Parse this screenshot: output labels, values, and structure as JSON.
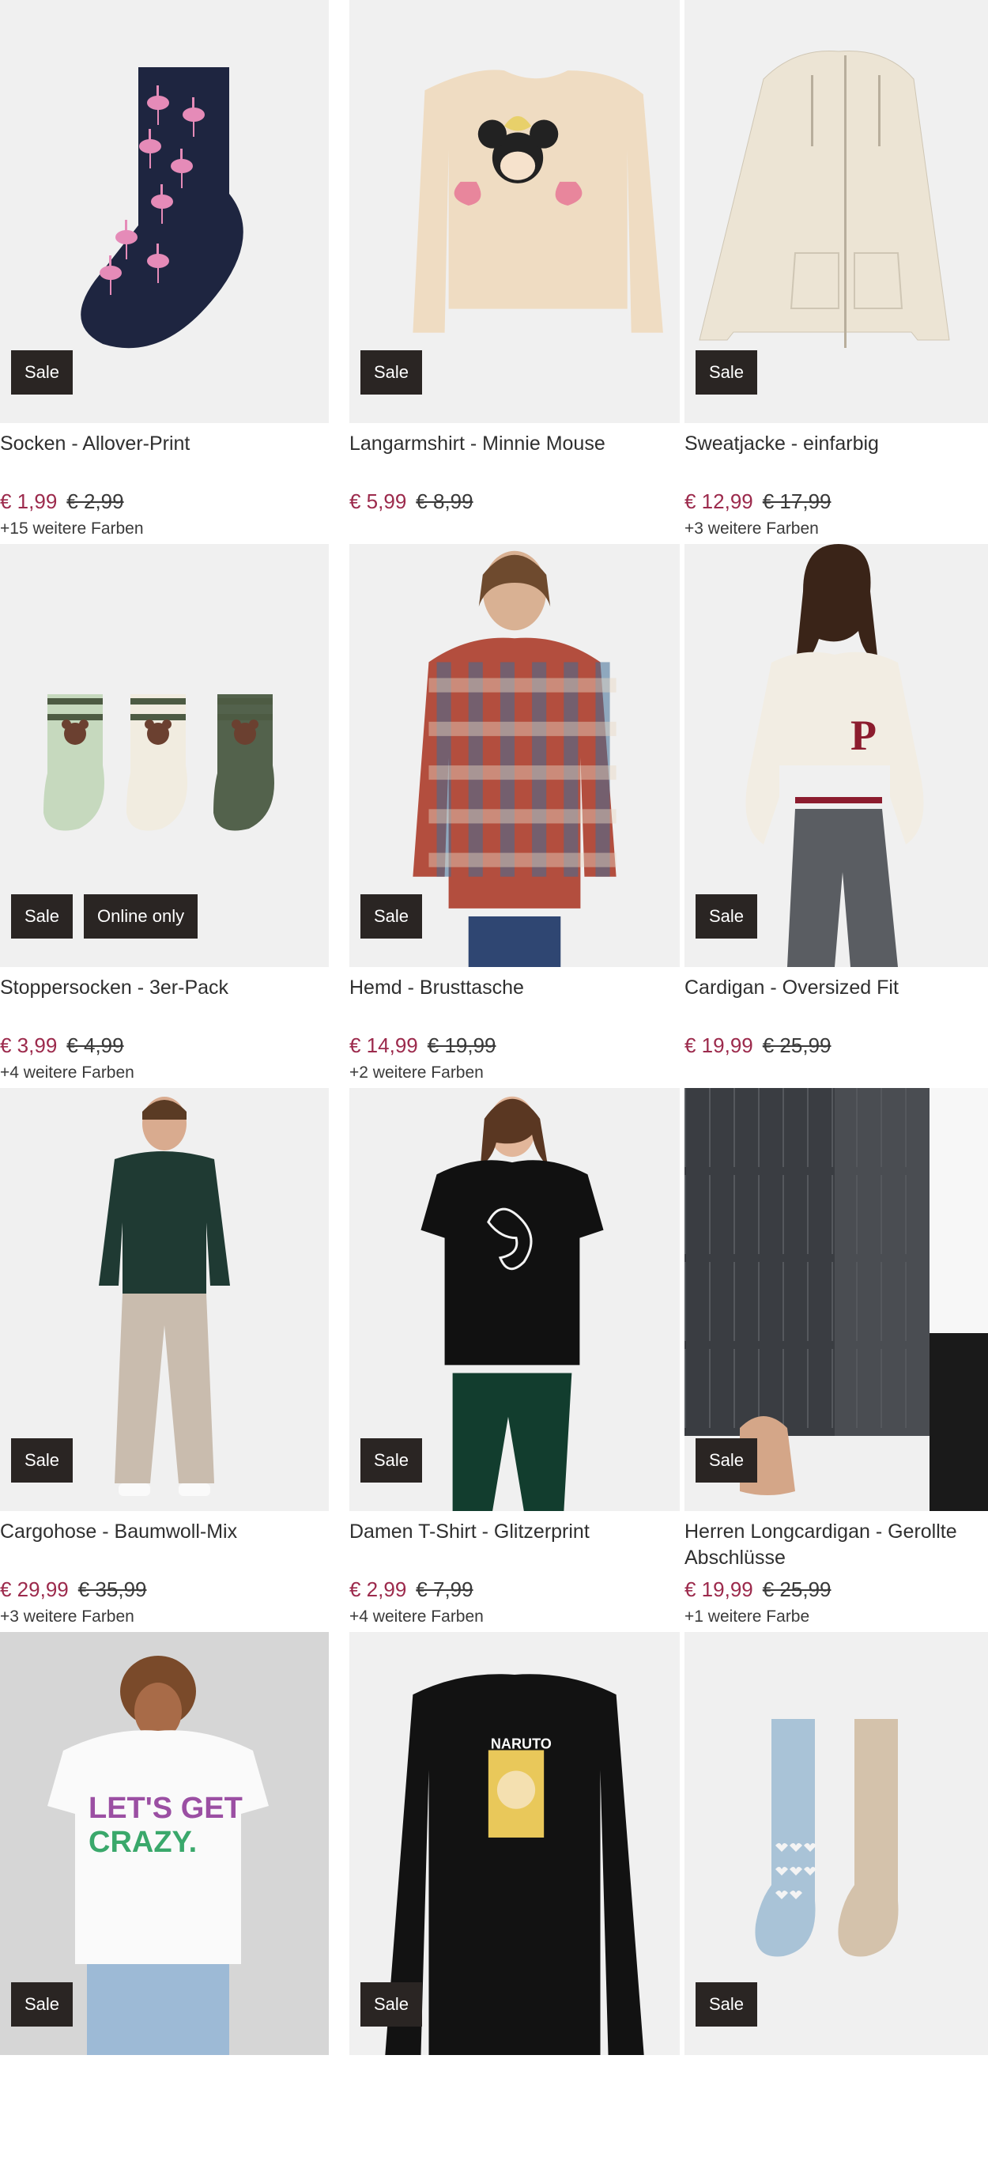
{
  "products": [
    {
      "name": "Socken - Allover-Print",
      "price": "€ 1,99",
      "old_price": "€ 2,99",
      "colors": "+15 weitere Farben",
      "badges": [
        "Sale"
      ],
      "image": "sock-flamingo"
    },
    {
      "name": "Langarmshirt - Minnie Mouse",
      "price": "€ 5,99",
      "old_price": "€ 8,99",
      "colors": "",
      "badges": [
        "Sale"
      ],
      "image": "longsleeve-minnie"
    },
    {
      "name": "Sweatjacke - einfarbig",
      "price": "€ 12,99",
      "old_price": "€ 17,99",
      "colors": "+3 weitere Farben",
      "badges": [
        "Sale"
      ],
      "image": "zip-hoodie"
    },
    {
      "name": "Stoppersocken - 3er-Pack",
      "price": "€ 3,99",
      "old_price": "€ 4,99",
      "colors": "+4 weitere Farben",
      "badges": [
        "Sale",
        "Online only"
      ],
      "image": "socks-3pack"
    },
    {
      "name": "Hemd - Brusttasche",
      "price": "€ 14,99",
      "old_price": "€ 19,99",
      "colors": "+2 weitere Farben",
      "badges": [
        "Sale"
      ],
      "image": "plaid-shirt-man"
    },
    {
      "name": "Cardigan - Oversized Fit",
      "price": "€ 19,99",
      "old_price": "€ 25,99",
      "colors": "",
      "badges": [
        "Sale"
      ],
      "image": "cardigan-woman"
    },
    {
      "name": "Cargohose - Baumwoll-Mix",
      "price": "€ 29,99",
      "old_price": "€ 35,99",
      "colors": "+3 weitere Farben",
      "badges": [
        "Sale"
      ],
      "image": "cargo-man"
    },
    {
      "name": "Damen T-Shirt - Glitzerprint",
      "price": "€ 2,99",
      "old_price": "€ 7,99",
      "colors": "+4 weitere Farben",
      "badges": [
        "Sale"
      ],
      "image": "tshirt-woman-black"
    },
    {
      "name": "Herren Longcardigan - Gerollte Abschlüsse",
      "price": "€ 19,99",
      "old_price": "€ 25,99",
      "colors": "+1 weitere Farbe",
      "badges": [
        "Sale"
      ],
      "image": "longcardigan-closeup"
    },
    {
      "name": "",
      "price": "",
      "old_price": "",
      "colors": "",
      "badges": [
        "Sale"
      ],
      "image": "tshirt-lets-get-crazy"
    },
    {
      "name": "",
      "price": "",
      "old_price": "",
      "colors": "",
      "badges": [
        "Sale"
      ],
      "image": "longsleeve-naruto"
    },
    {
      "name": "",
      "price": "",
      "old_price": "",
      "colors": "",
      "badges": [
        "Sale"
      ],
      "image": "tights-kids"
    }
  ],
  "artwork_text": {
    "crazy_line1": "LET'S GET",
    "crazy_line2": "CRAZY.",
    "naruto": "NARUTO",
    "cardigan_letter": "P"
  },
  "colors": {
    "sale_price": "#9c2a4c",
    "badge_bg": "#2a2523",
    "image_bg": "#f0f0f0"
  }
}
